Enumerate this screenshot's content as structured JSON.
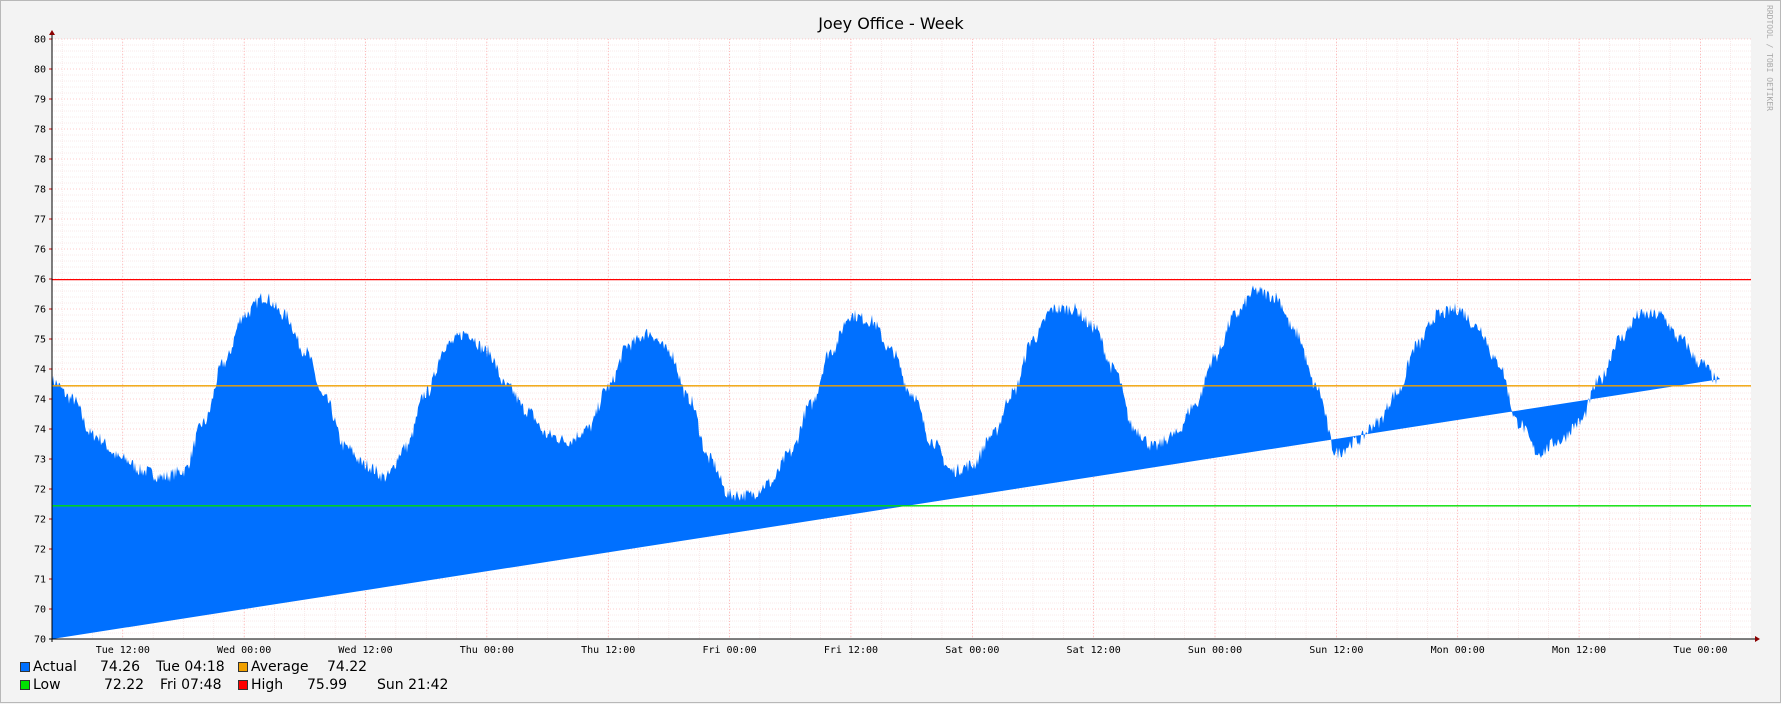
{
  "chart_data": {
    "type": "area",
    "title": "Joey Office - Week",
    "xlabel": "",
    "ylabel": "",
    "ylim": [
      70,
      80
    ],
    "y_tick_labels": [
      "80",
      "80",
      "79",
      "78",
      "78",
      "78",
      "77",
      "76",
      "76",
      "76",
      "75",
      "74",
      "74",
      "74",
      "73",
      "72",
      "72",
      "72",
      "71",
      "70",
      "70"
    ],
    "x_tick_labels": [
      "Tue 12:00",
      "Wed 00:00",
      "Wed 12:00",
      "Thu 00:00",
      "Thu 12:00",
      "Fri 00:00",
      "Fri 12:00",
      "Sat 00:00",
      "Sat 12:00",
      "Sun 00:00",
      "Sun 12:00",
      "Mon 00:00",
      "Mon 12:00",
      "Tue 00:00"
    ],
    "x_range_hours": [
      -7,
      161
    ],
    "grid": true,
    "series": [
      {
        "name": "Actual",
        "color": "#0070ff",
        "style": "area",
        "x_hours": [
          -7,
          -5,
          -3,
          0,
          2,
          4,
          6,
          8,
          10,
          12,
          14,
          16,
          18,
          20,
          22,
          24,
          26,
          28,
          30,
          32,
          34,
          36,
          38,
          40,
          42,
          44,
          46,
          48,
          50,
          52,
          54,
          56,
          58,
          60,
          62,
          64,
          66,
          68,
          70,
          72,
          74,
          76,
          78,
          80,
          82,
          84,
          86,
          88,
          90,
          92,
          94,
          96,
          98,
          100,
          102,
          104,
          106,
          108,
          110,
          112,
          114,
          116,
          118,
          120,
          122,
          124,
          126,
          128,
          130,
          132,
          134,
          136,
          138,
          140,
          142,
          144,
          146,
          148,
          150,
          152,
          154,
          156,
          158,
          160,
          161
        ],
        "values": [
          74.3,
          74.0,
          73.4,
          73.0,
          72.8,
          72.7,
          72.8,
          73.6,
          74.6,
          75.4,
          75.7,
          75.4,
          74.8,
          74.0,
          73.2,
          72.9,
          72.7,
          73.2,
          74.1,
          74.9,
          75.1,
          74.8,
          74.2,
          73.8,
          73.4,
          73.3,
          73.5,
          74.2,
          74.9,
          75.1,
          74.8,
          74.0,
          73.0,
          72.4,
          72.4,
          72.6,
          73.1,
          73.9,
          74.8,
          75.4,
          75.3,
          74.8,
          74.1,
          73.3,
          72.8,
          72.9,
          73.4,
          74.1,
          75.0,
          75.5,
          75.5,
          75.2,
          74.5,
          73.5,
          73.2,
          73.4,
          73.9,
          74.7,
          75.4,
          75.8,
          75.7,
          75.1,
          74.2,
          73.1,
          73.3,
          73.6,
          74.1,
          74.9,
          75.4,
          75.5,
          75.2,
          74.6,
          73.6,
          73.1,
          73.3,
          73.6,
          74.3,
          75.0,
          75.4,
          75.4,
          75.0,
          74.6,
          74.26
        ]
      },
      {
        "name": "Average",
        "color": "#f0a000",
        "style": "line",
        "value": 74.22
      },
      {
        "name": "Low",
        "color": "#00e000",
        "style": "line",
        "value": 72.22
      },
      {
        "name": "High",
        "color": "#ff0000",
        "style": "line",
        "value": 75.99
      }
    ],
    "legend": [
      {
        "name": "Actual",
        "color": "#0070ff",
        "value": "74.26",
        "time": "Tue 04:18"
      },
      {
        "name": "Average",
        "color": "#f0a000",
        "value": "74.22",
        "time": ""
      },
      {
        "name": "Low",
        "color": "#00e000",
        "value": "72.22",
        "time": "Fri 07:48"
      },
      {
        "name": "High",
        "color": "#ff0000",
        "value": "75.99",
        "time": "Sun 21:42"
      }
    ],
    "watermark": "RRDTOOL / TOBI OETIKER"
  }
}
